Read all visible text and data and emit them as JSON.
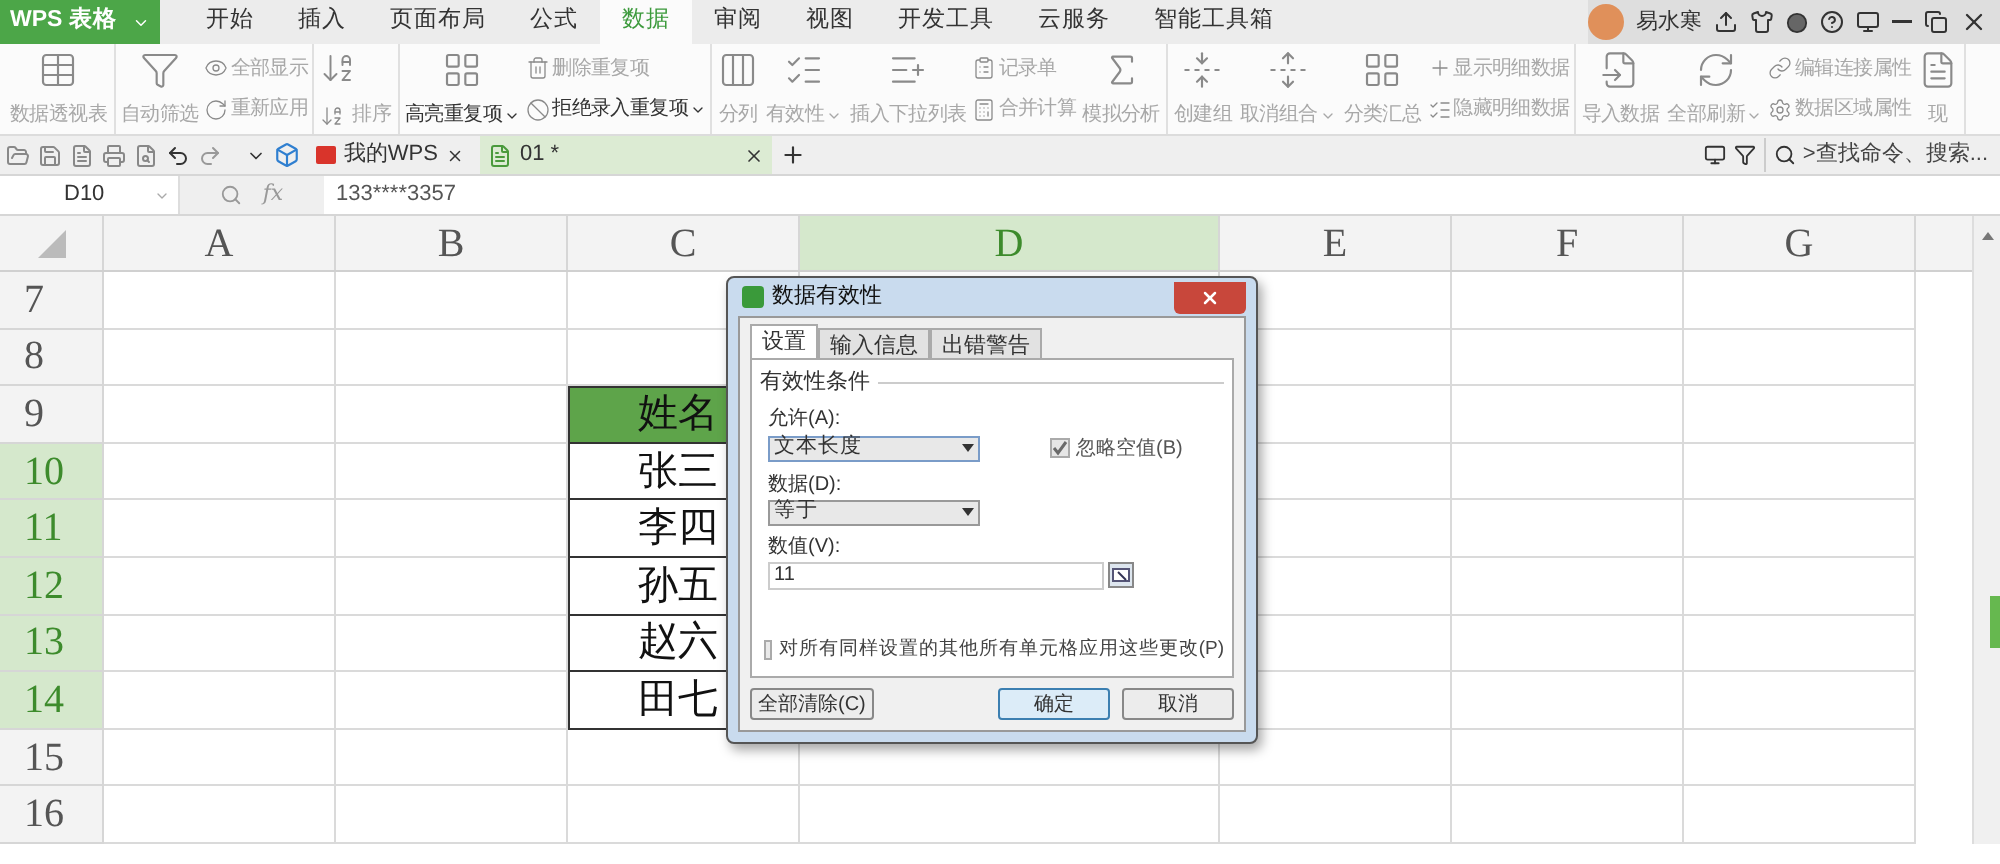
{
  "app_button": {
    "label": "WPS 表格"
  },
  "menu_tabs": [
    {
      "label": "开始",
      "selected": false
    },
    {
      "label": "插入",
      "selected": false
    },
    {
      "label": "页面布局",
      "selected": false
    },
    {
      "label": "公式",
      "selected": false
    },
    {
      "label": "数据",
      "selected": true
    },
    {
      "label": "审阅",
      "selected": false
    },
    {
      "label": "视图",
      "selected": false
    },
    {
      "label": "开发工具",
      "selected": false
    },
    {
      "label": "云服务",
      "selected": false
    },
    {
      "label": "智能工具箱",
      "selected": false
    }
  ],
  "user": {
    "name": "易水寒"
  },
  "ribbon": {
    "groups": [
      {
        "items": [
          {
            "kind": "large",
            "label": "数据透视表",
            "disabled": true,
            "dropdown": false
          }
        ]
      },
      {
        "items": [
          {
            "kind": "large",
            "label": "自动筛选",
            "disabled": true,
            "dropdown": false
          },
          {
            "kind": "stack",
            "items": [
              {
                "label": "全部显示",
                "disabled": true,
                "dropdown": false
              },
              {
                "label": "重新应用",
                "disabled": true,
                "dropdown": false
              }
            ]
          }
        ]
      },
      {
        "items": [
          {
            "kind": "sort",
            "label": "排序",
            "disabled": true
          }
        ]
      },
      {
        "items": [
          {
            "kind": "large",
            "label": "高亮重复项",
            "disabled": false,
            "dropdown": true
          },
          {
            "kind": "stack",
            "items": [
              {
                "label": "删除重复项",
                "disabled": true,
                "dropdown": false
              },
              {
                "label": "拒绝录入重复项",
                "disabled": false,
                "dropdown": true
              }
            ]
          }
        ]
      },
      {
        "items": [
          {
            "kind": "large",
            "label": "分列",
            "disabled": true,
            "dropdown": false
          },
          {
            "kind": "large",
            "label": "有效性",
            "disabled": true,
            "dropdown": true
          },
          {
            "kind": "large",
            "label": "插入下拉列表",
            "disabled": true,
            "dropdown": false
          },
          {
            "kind": "stack",
            "items": [
              {
                "label": "记录单",
                "disabled": true,
                "dropdown": false
              },
              {
                "label": "合并计算",
                "disabled": true,
                "dropdown": false
              }
            ]
          },
          {
            "kind": "large",
            "label": "模拟分析",
            "disabled": true,
            "dropdown": false
          }
        ]
      },
      {
        "items": [
          {
            "kind": "large",
            "label": "创建组",
            "disabled": true,
            "dropdown": false
          },
          {
            "kind": "large",
            "label": "取消组合",
            "disabled": true,
            "dropdown": true
          },
          {
            "kind": "large",
            "label": "分类汇总",
            "disabled": true,
            "dropdown": false
          },
          {
            "kind": "stack",
            "items": [
              {
                "label": "显示明细数据",
                "disabled": true,
                "dropdown": false
              },
              {
                "label": "隐藏明细数据",
                "disabled": true,
                "dropdown": false
              }
            ]
          }
        ]
      },
      {
        "items": [
          {
            "kind": "large",
            "label": "导入数据",
            "disabled": true,
            "dropdown": false
          },
          {
            "kind": "large",
            "label": "全部刷新",
            "disabled": true,
            "dropdown": true
          },
          {
            "kind": "stack",
            "items": [
              {
                "label": "编辑连接属性",
                "disabled": true,
                "dropdown": false
              },
              {
                "label": "数据区域属性",
                "disabled": true,
                "dropdown": false
              }
            ]
          },
          {
            "kind": "large",
            "label": "现",
            "disabled": true,
            "dropdown": false
          }
        ]
      }
    ]
  },
  "doc_tabs": [
    {
      "kind": "home",
      "label": "我的WPS",
      "selected": false
    },
    {
      "kind": "sheet",
      "label": "01 *",
      "selected": true
    }
  ],
  "command_search": {
    "placeholder": ">查找命令、搜索..."
  },
  "formula_bar": {
    "cell_ref": "D10",
    "function_label": "fx",
    "value": "133****3357"
  },
  "sheet": {
    "columns": [
      {
        "label": "A",
        "selected": false
      },
      {
        "label": "B",
        "selected": false
      },
      {
        "label": "C",
        "selected": false
      },
      {
        "label": "D",
        "selected": true
      },
      {
        "label": "E",
        "selected": false
      },
      {
        "label": "F",
        "selected": false
      },
      {
        "label": "G",
        "selected": false
      }
    ],
    "rows": [
      {
        "label": "7",
        "selected": false
      },
      {
        "label": "8",
        "selected": false
      },
      {
        "label": "9",
        "selected": false,
        "cell_c": {
          "kind": "header",
          "text": "姓名"
        }
      },
      {
        "label": "10",
        "selected": true,
        "cell_c": {
          "kind": "data",
          "text": "张三"
        }
      },
      {
        "label": "11",
        "selected": true,
        "cell_c": {
          "kind": "data",
          "text": "李四"
        }
      },
      {
        "label": "12",
        "selected": true,
        "cell_c": {
          "kind": "data",
          "text": "孙五"
        }
      },
      {
        "label": "13",
        "selected": true,
        "cell_c": {
          "kind": "data",
          "text": "赵六"
        }
      },
      {
        "label": "14",
        "selected": true,
        "cell_c": {
          "kind": "data",
          "text": "田七"
        }
      },
      {
        "label": "15",
        "selected": false
      },
      {
        "label": "16",
        "selected": false
      }
    ]
  },
  "dialog": {
    "title": "数据有效性",
    "tabs": [
      {
        "label": "设置",
        "selected": true
      },
      {
        "label": "输入信息",
        "selected": false
      },
      {
        "label": "出错警告",
        "selected": false
      }
    ],
    "section": "有效性条件",
    "allow": {
      "label": "允许(A):",
      "value": "文本长度"
    },
    "ignore_blank": {
      "label": "忽略空值(B)",
      "checked": true,
      "disabled": true
    },
    "data": {
      "label": "数据(D):",
      "value": "等于"
    },
    "value": {
      "label": "数值(V):",
      "value": "11"
    },
    "apply_all": {
      "label": "对所有同样设置的其他所有单元格应用这些更改(P)",
      "checked": false,
      "disabled": true
    },
    "buttons": [
      {
        "kind": "secondary",
        "label": "全部清除(C)"
      },
      {
        "kind": "default",
        "label": "确定"
      },
      {
        "kind": "secondary",
        "label": "取消"
      }
    ]
  }
}
